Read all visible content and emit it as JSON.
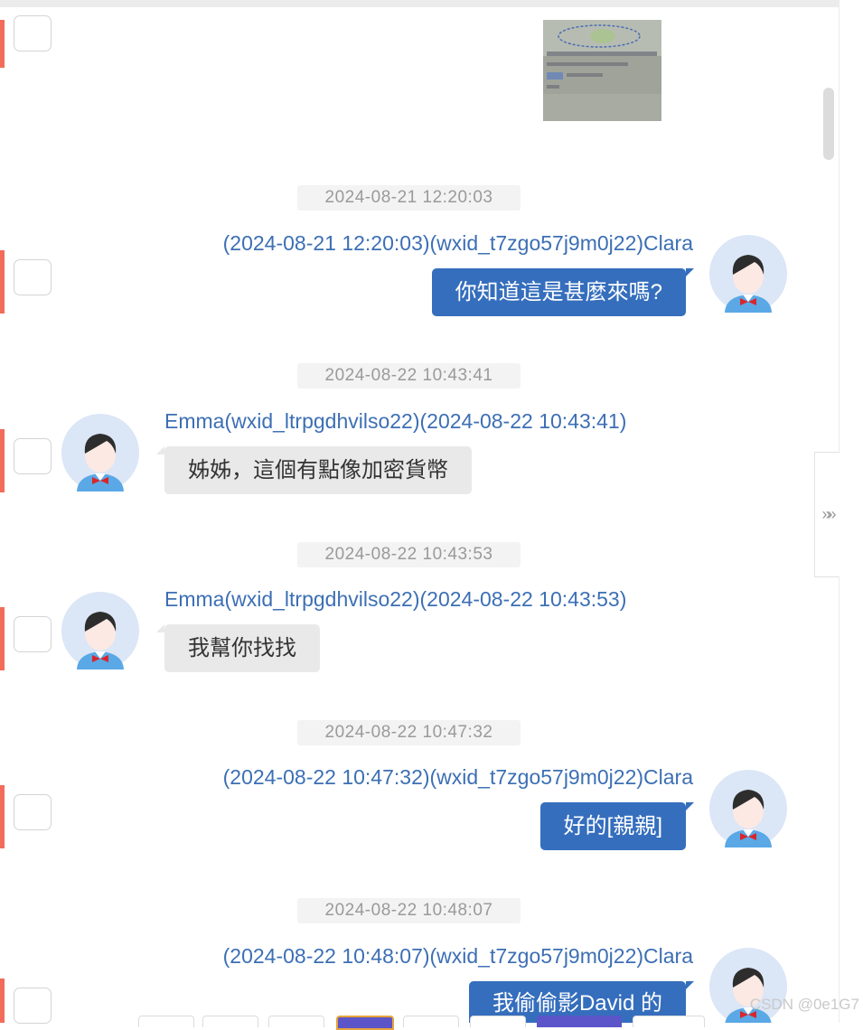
{
  "colors": {
    "accent_marker": "#f26b5b",
    "outgoing_bubble": "#356ebd",
    "incoming_bubble": "#e9e9e9",
    "sender_text": "#3c6fb4"
  },
  "icons": {
    "expand_handle": "chevron-double-right-icon",
    "avatar": "user-avatar-icon"
  },
  "collapse_handle": {
    "glyph": "»»"
  },
  "messages": [
    {
      "timestamp": "2024-08-21 12:20:03",
      "direction": "out",
      "sender_label": "(2024-08-21 12:20:03)(wxid_t7zgo57j9m0j22)Clara",
      "text": "你知道這是甚麼來嗎?"
    },
    {
      "timestamp": "2024-08-22 10:43:41",
      "direction": "in",
      "sender_label": "Emma(wxid_ltrpgdhvilso22)(2024-08-22 10:43:41)",
      "text": "姊姊，這個有點像加密貨幣"
    },
    {
      "timestamp": "2024-08-22 10:43:53",
      "direction": "in",
      "sender_label": "Emma(wxid_ltrpgdhvilso22)(2024-08-22 10:43:53)",
      "text": "我幫你找找"
    },
    {
      "timestamp": "2024-08-22 10:47:32",
      "direction": "out",
      "sender_label": "(2024-08-22 10:47:32)(wxid_t7zgo57j9m0j22)Clara",
      "text": "好的[親親]"
    },
    {
      "timestamp": "2024-08-22 10:48:07",
      "direction": "out",
      "sender_label": "(2024-08-22 10:48:07)(wxid_t7zgo57j9m0j22)Clara",
      "text": "我偷偷影David 的"
    }
  ],
  "watermark": "CSDN @0e1G7"
}
